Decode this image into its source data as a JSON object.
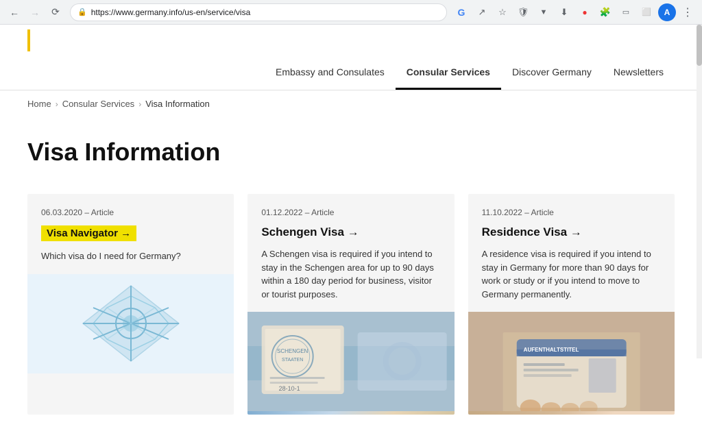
{
  "browser": {
    "url": "https://www.germany.info/us-en/service/visa",
    "back_disabled": false,
    "forward_disabled": false
  },
  "header": {
    "nav": [
      {
        "id": "embassy",
        "label": "Embassy and Consulates",
        "active": false
      },
      {
        "id": "consular",
        "label": "Consular Services",
        "active": true
      },
      {
        "id": "discover",
        "label": "Discover Germany",
        "active": false
      },
      {
        "id": "newsletters",
        "label": "Newsletters",
        "active": false
      }
    ]
  },
  "breadcrumb": {
    "home": "Home",
    "consular": "Consular Services",
    "current": "Visa Information"
  },
  "page": {
    "title": "Visa Information"
  },
  "cards": [
    {
      "id": "visa-navigator",
      "date": "06.03.2020 – Article",
      "title": "Visa Navigator →",
      "title_highlighted": true,
      "description": "Which visa do I need for Germany?",
      "has_image": true,
      "image_type": "illustration"
    },
    {
      "id": "schengen-visa",
      "date": "01.12.2022 – Article",
      "title": "Schengen Visa →",
      "title_highlighted": false,
      "description": "A Schengen visa is required if you intend to stay in the Schengen area for up to 90 days within a 180 day period for business, visitor or tourist purposes.",
      "has_image": true,
      "image_type": "schengen-photo"
    },
    {
      "id": "residence-visa",
      "date": "11.10.2022 – Article",
      "title": "Residence Visa →",
      "title_highlighted": false,
      "description": "A residence visa is required if you intend to stay in Germany for more than 90 days for work or study or if you intend to move to Germany permanently.",
      "has_image": true,
      "image_type": "residence-photo"
    }
  ]
}
